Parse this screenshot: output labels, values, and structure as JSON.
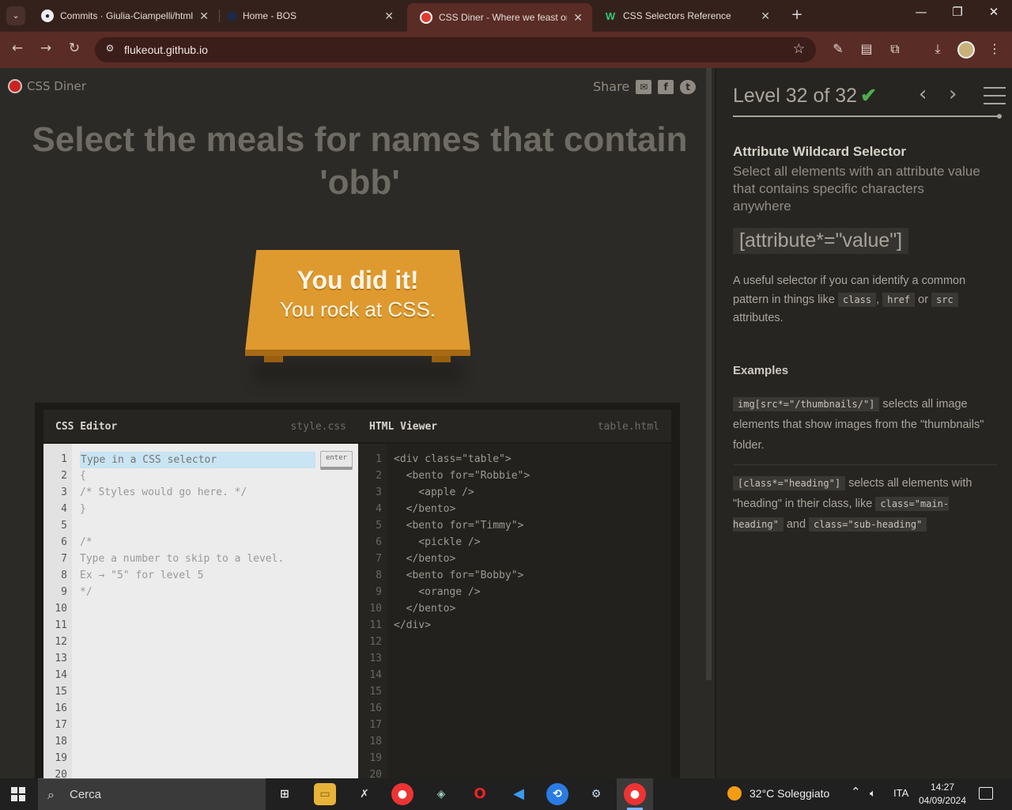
{
  "browser": {
    "tabs": [
      {
        "title": "Commits · Giulia-Ciampelli/html",
        "icon": "github-icon"
      },
      {
        "title": "Home - BOS",
        "icon": "bos-icon"
      },
      {
        "title": "CSS Diner - Where we feast on",
        "icon": "css-diner-icon"
      },
      {
        "title": "CSS Selectors Reference",
        "icon": "w3schools-icon"
      }
    ],
    "url": "flukeout.github.io",
    "accent": "#5a2c26"
  },
  "header": {
    "logo": "CSS Diner",
    "share_label": "Share"
  },
  "order": "Select the meals for names that contain 'obb'",
  "win_title": "You did it!",
  "win_sub": "You rock at CSS.",
  "editor": {
    "css_title": "CSS Editor",
    "css_file": "style.css",
    "html_title": "HTML Viewer",
    "html_file": "table.html",
    "input_placeholder": "Type in a CSS selector",
    "enter_label": "enter",
    "css_lines": [
      "{",
      "/* Styles would go here. */",
      "}",
      "",
      "/*",
      "Type a number to skip to a level.",
      "Ex → \"5\" for level 5",
      "*/"
    ],
    "html_lines": [
      "<div class=\"table\">",
      "  <bento for=\"Robbie\">",
      "    <apple />",
      "  </bento>",
      "  <bento for=\"Timmy\">",
      "    <pickle />",
      "  </bento>",
      "  <bento for=\"Bobby\">",
      "    <orange />",
      "  </bento>",
      "</div>"
    ],
    "line_numbers": [
      "1",
      "2",
      "3",
      "4",
      "5",
      "6",
      "7",
      "8",
      "9",
      "10",
      "11",
      "12",
      "13",
      "14",
      "15",
      "16",
      "17",
      "18",
      "19",
      "20"
    ]
  },
  "sidebar": {
    "level_label": "Level 32 of 32",
    "check": "✔",
    "progress": 1.0,
    "selector_name": "Attribute Wildcard Selector",
    "selector_desc": "Select all elements with an attribute value that contains specific characters anywhere",
    "syntax": "[attribute*=\"value\"]",
    "hint_pre": "A useful selector if you can identify a common pattern in things like",
    "hint_code1": "class",
    "hint_code2": "href",
    "hint_or": "or",
    "hint_code3": "src",
    "hint_post": "attributes.",
    "examples_title": "Examples",
    "ex1_code": "img[src*=\"/thumbnails/\"]",
    "ex1_text": "selects all image elements that show images from the \"thumbnails\" folder.",
    "ex2_code": "[class*=\"heading\"]",
    "ex2_text": "selects all elements with \"heading\" in their class, like",
    "ex2_code2": "class=\"main-heading\"",
    "ex2_and": "and",
    "ex2_code3": "class=\"sub-heading\""
  },
  "taskbar": {
    "search_placeholder": "Cerca",
    "weather": "32°C  Soleggiato",
    "lang": "ITA",
    "time": "14:27",
    "date": "04/09/2024"
  }
}
